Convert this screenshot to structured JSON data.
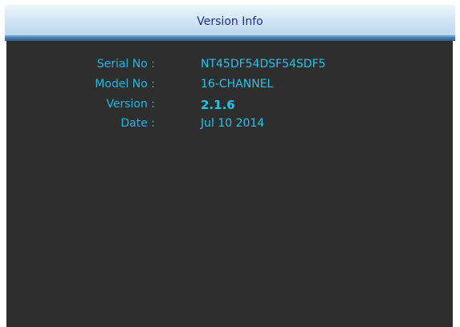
{
  "window": {
    "title": "Version Info"
  },
  "info": {
    "rows": [
      {
        "label": "Serial No :",
        "value": "NT45DF54DSF54SDF5"
      },
      {
        "label": "Model No :",
        "value": "16-CHANNEL"
      },
      {
        "label": "Version :",
        "value": "2.1.6"
      },
      {
        "label": "Date :",
        "value": "Jul 10 2014"
      }
    ]
  },
  "colors": {
    "panel_background": "#2e2e2e",
    "text_accent": "#27c2ea",
    "title_text": "#1a2f8c",
    "title_bar": "#d5e7f6"
  }
}
